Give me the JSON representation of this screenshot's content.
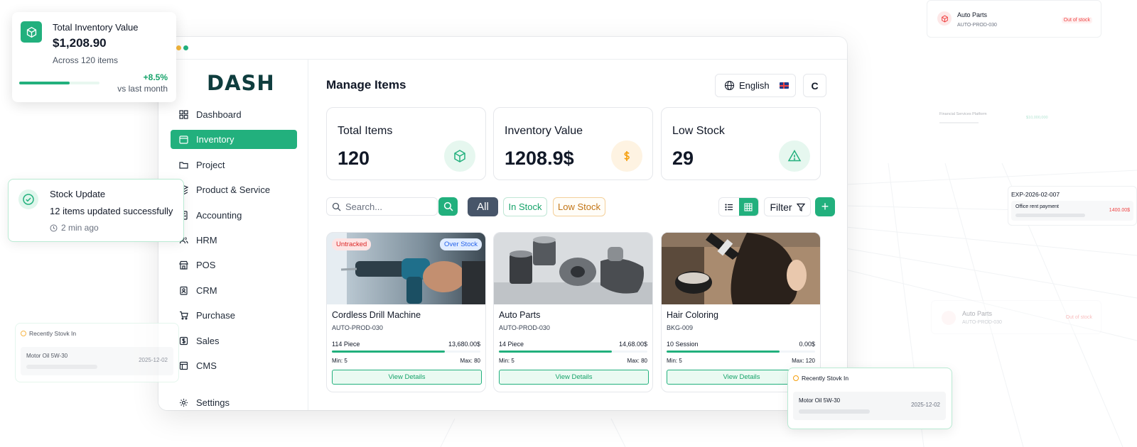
{
  "app": {
    "logo": "DASH",
    "page_title": "Manage Items",
    "language": "English",
    "avatar_initial": "C"
  },
  "sidebar": {
    "items": [
      {
        "label": "Dashboard",
        "icon": "grid-icon",
        "active": false
      },
      {
        "label": "Inventory",
        "icon": "calendar-icon",
        "active": true
      },
      {
        "label": "Project",
        "icon": "folder-icon",
        "active": false
      },
      {
        "label": "Product & Service",
        "icon": "layers-icon",
        "active": false
      },
      {
        "label": "Accounting",
        "icon": "calculator-icon",
        "active": false
      },
      {
        "label": "HRM",
        "icon": "users-icon",
        "active": false
      },
      {
        "label": "POS",
        "icon": "store-icon",
        "active": false
      },
      {
        "label": "CRM",
        "icon": "contact-icon",
        "active": false
      },
      {
        "label": "Purchase",
        "icon": "cart-icon",
        "active": false
      },
      {
        "label": "Sales",
        "icon": "dollar-icon",
        "active": false
      },
      {
        "label": "CMS",
        "icon": "layout-icon",
        "active": false
      }
    ],
    "settings": {
      "label": "Settings",
      "icon": "gear-icon"
    }
  },
  "stats": [
    {
      "label": "Total Items",
      "value": "120",
      "icon": "box-icon",
      "color": "#22b07d",
      "bg": "#e6f7ef"
    },
    {
      "label": "Inventory Value",
      "value": "1208.9$",
      "icon": "dollar-icon",
      "color": "#f59e0b",
      "bg": "#fef3e2"
    },
    {
      "label": "Low Stock",
      "value": "29",
      "icon": "warning-icon",
      "color": "#22b07d",
      "bg": "#e6f7ef"
    }
  ],
  "toolbar": {
    "search_placeholder": "Search...",
    "chip_all": "All",
    "chip_in_stock": "In Stock",
    "chip_low_stock": "Low Stock",
    "filter_label": "Filter",
    "add_label": "+"
  },
  "products": [
    {
      "name": "Cordless Drill Machine",
      "sku": "AUTO-PROD-030",
      "qty": "114 Piece",
      "amount": "13,680.00$",
      "progress": 0.76,
      "min": "Min: 5",
      "max": "Max: 80",
      "badge_left": "Untracked",
      "badge_right": "Over Stock",
      "button": "View Details"
    },
    {
      "name": "Auto Parts",
      "sku": "AUTO-PROD-030",
      "qty": "14 Piece",
      "amount": "14,68.00$",
      "progress": 0.76,
      "min": "Min: 5",
      "max": "Max: 80",
      "button": "View Details"
    },
    {
      "name": "Hair Coloring",
      "sku": "BKG-009",
      "qty": "10 Session",
      "amount": "0.00$",
      "progress": 0.76,
      "min": "Min: 5",
      "max": "Max: 120",
      "button": "View Details"
    }
  ],
  "widgets": {
    "total_value": {
      "title": "Total Inventory Value",
      "value": "$1,208.90",
      "sub": "Across 120 items",
      "change": "+8.5%",
      "compare": "vs last month",
      "progress": 0.63
    },
    "stock_update": {
      "title": "Stock Update",
      "message": "12 items updated successfully",
      "time": "2 min ago"
    },
    "recent_left": {
      "title": "Recently Stovk In",
      "item": "Motor Oil 5W-30",
      "date": "2025-12-02"
    },
    "recent_right": {
      "title": "Recently Stovk In",
      "item": "Motor Oil 5W-30",
      "date": "2025-12-02"
    },
    "auto_top": {
      "title": "Auto Parts",
      "sku": "AUTO-PROD-030",
      "badge": "Out of stock"
    },
    "auto_faint": {
      "title": "Auto Parts",
      "sku": "AUTO-PROD-030",
      "badge": "Out of stock"
    },
    "expense": {
      "id": "EXP-2026-02-007",
      "desc": "Office rent payment",
      "amount": "1400.00$"
    },
    "financial": {
      "title": "Financial Services Platform",
      "value": "$10,000,000"
    }
  }
}
